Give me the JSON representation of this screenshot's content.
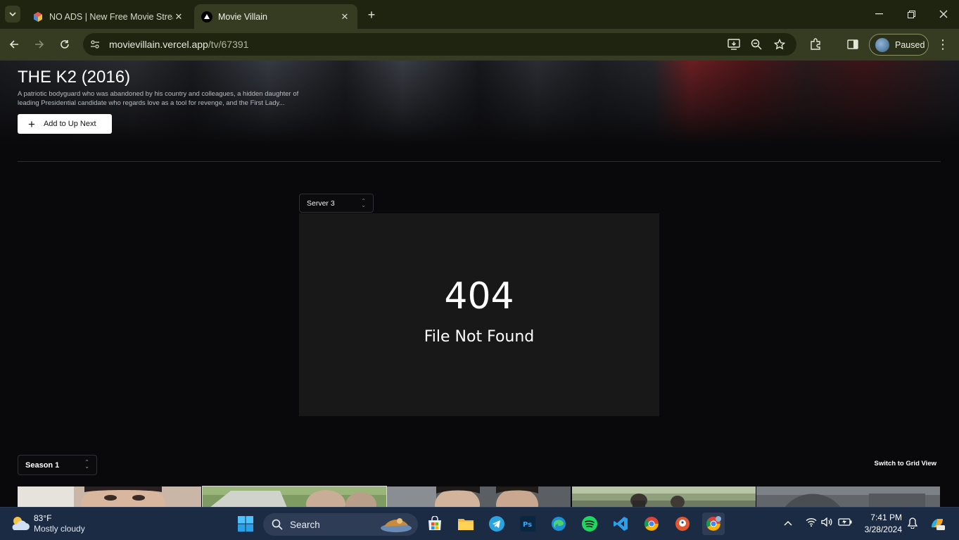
{
  "browser": {
    "tabs": [
      {
        "title": "NO ADS | New Free Movie Strea",
        "active": false
      },
      {
        "title": "Movie Villain",
        "active": true
      }
    ],
    "url_host": "movievillain.vercel.app",
    "url_path": "/tv/67391",
    "profile_label": "Paused"
  },
  "page": {
    "show_title": "THE K2 (2016)",
    "overview": "A patriotic bodyguard who was abandoned by his country and colleagues, a hidden daughter of leading Presidential candidate who regards love as a tool for revenge, and the First Lady...",
    "add_button_label": "Add to Up Next",
    "server_select_value": "Server 3",
    "player": {
      "error_code": "404",
      "error_message": "File Not Found"
    },
    "season_select_value": "Season 1",
    "grid_view_label": "Switch to Grid View",
    "selected_episode_index": 1
  },
  "taskbar": {
    "weather_temp": "83°F",
    "weather_condition": "Mostly cloudy",
    "search_placeholder": "Search",
    "time": "7:41 PM",
    "date": "3/28/2024",
    "apps": [
      "start-icon",
      "microsoft-store-icon",
      "file-explorer-icon",
      "telegram-icon",
      "photoshop-icon",
      "edge-icon",
      "spotify-icon",
      "vscode-icon",
      "chrome-icon",
      "duckduckgo-icon",
      "chrome-profile-icon"
    ]
  },
  "colors": {
    "chrome_frame": "#1f2410",
    "chrome_toolbar": "#363c22",
    "page_background": "#09090b",
    "player_background": "#181818",
    "taskbar": "#1c2b44"
  }
}
